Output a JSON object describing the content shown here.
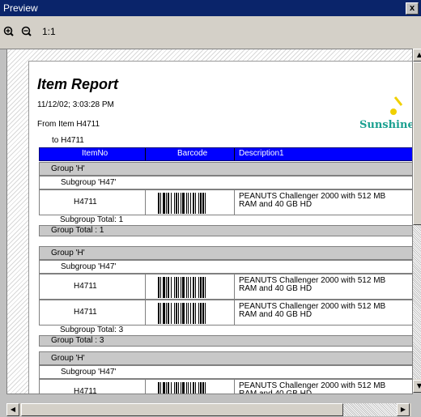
{
  "window": {
    "title": "Preview",
    "close_label": "x"
  },
  "toolbar": {
    "zoom_in_icon": "zoom-in-icon",
    "zoom_out_icon": "zoom-out-icon",
    "actual_size_label": "1:1"
  },
  "report": {
    "title": "Item Report",
    "date": "11/12/02; 3:03:28 PM",
    "from": "From Item H4711",
    "to": "to H4711",
    "logo_text": "Sunshine",
    "columns": [
      "ItemNo",
      "Barcode",
      "Description1"
    ],
    "group_label": "Group 'H'",
    "subgroup_label": "Subgroup 'H47'",
    "item_no": "H4711",
    "description_line1": "PEANUTS Challenger 2000 with 512 MB",
    "description_line2": "RAM and 40 GB HD",
    "subgroup_total_1": "Subgroup Total:  1",
    "group_total_1": "Group Total :  1",
    "subgroup_total_3": "Subgroup Total:  3",
    "group_total_3": "Group Total :  3"
  },
  "colors": {
    "header_bg": "#0000ff",
    "group_bg": "#c8c8c8",
    "titlebar": "#0a246a"
  }
}
